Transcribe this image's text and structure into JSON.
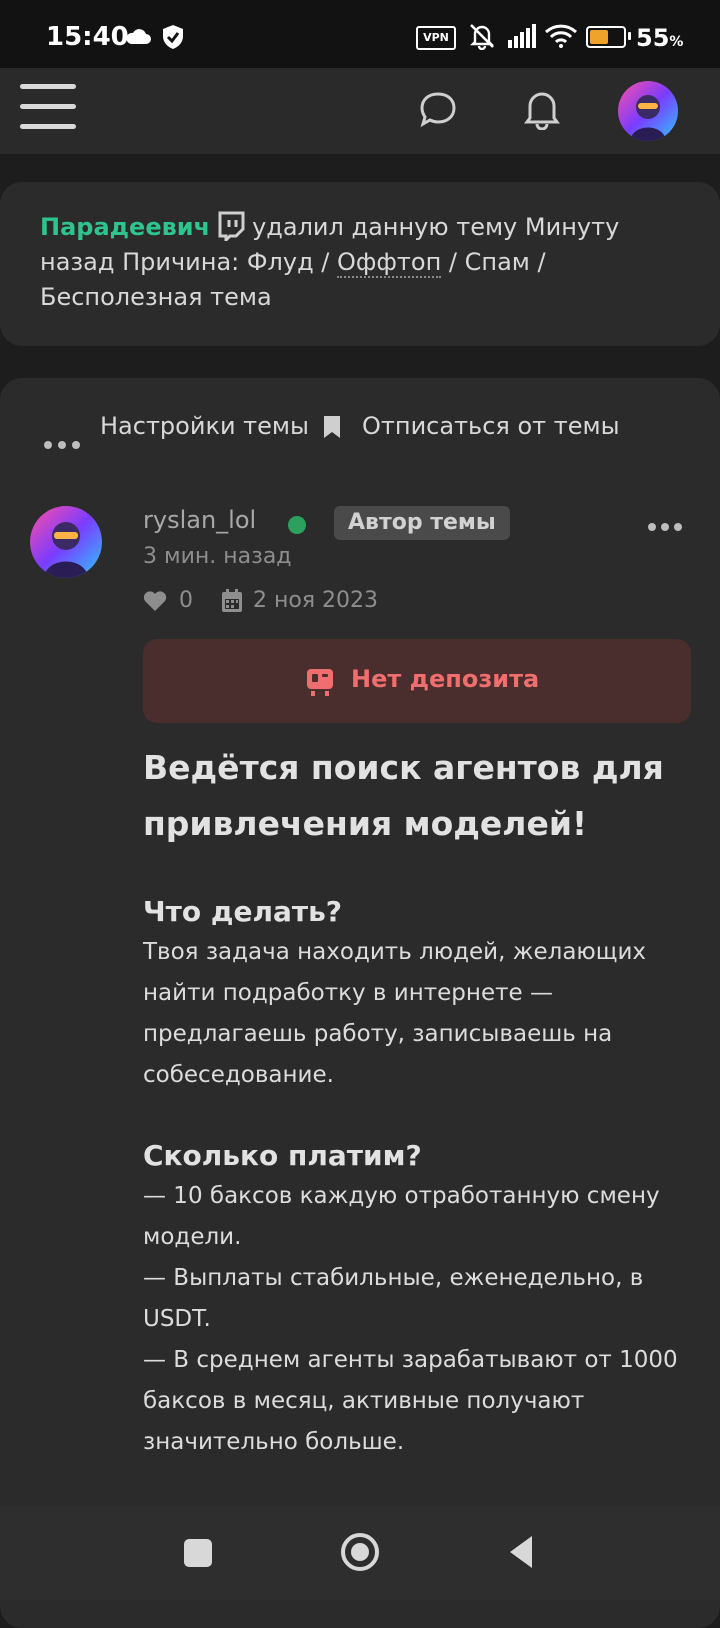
{
  "status_bar": {
    "time": "15:40",
    "vpn": "VPN",
    "battery_percent": "55",
    "battery_suffix": "%",
    "battery_level": 0.55
  },
  "header": {
    "icons": [
      "menu-icon",
      "chat-icon",
      "bell-icon",
      "avatar"
    ]
  },
  "notice": {
    "user": "Парадеевич",
    "text_1": "удалил данную тему Минуту назад Причина: Флуд / ",
    "text_link": "Оффтоп",
    "text_2": " / Спам / Бесполезная тема"
  },
  "thread_actions": {
    "settings_label": "Настройки темы",
    "unsubscribe_label": "Отписаться от темы"
  },
  "post": {
    "username": "ryslan_lol",
    "author_badge": "Автор темы",
    "time": "3 мин. назад",
    "likes": "0",
    "date": "2 ноя 2023",
    "deposit_label": "Нет депозита",
    "title": "Ведётся поиск агентов для привлечения моделей!",
    "section1_head": "Что делать?",
    "section1_text": "Твоя задача находить людей, желающих найти подработку в интернете — предлагаешь работу, записываешь на собеседование.",
    "section2_head": "Сколько платим?",
    "section2_text": "— 10 баксов каждую отработанную смену модели.\n— Выплаты стабильные, еженедельно, в USDT.\n— В среднем агенты зарабатывают от 1000 баксов в месяц, активные получают значительно больше."
  },
  "colors": {
    "accent_green": "#2ec48e",
    "online": "#2ca15e",
    "deposit_bg": "#4a2d2d",
    "deposit_text": "#f06e6e",
    "battery": "#f0a32a"
  }
}
